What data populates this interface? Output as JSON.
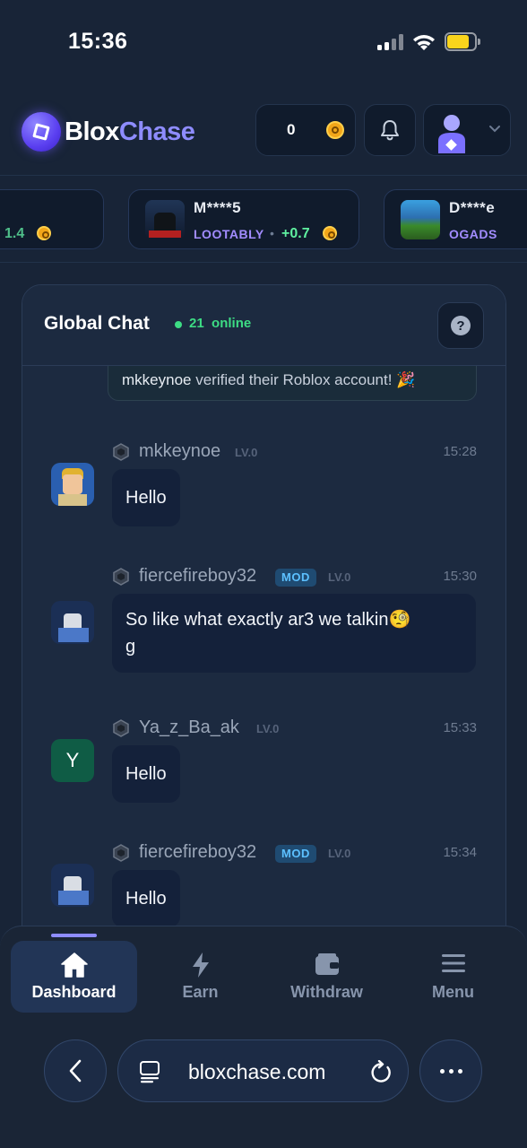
{
  "status_bar": {
    "time": "15:36"
  },
  "header": {
    "logo": {
      "part1": "Blox",
      "part2": "Chase"
    },
    "balance": "0"
  },
  "ticker": [
    {
      "name": "",
      "source": "",
      "amount": "1.4"
    },
    {
      "name": "M****5",
      "source": "LOOTABLY",
      "amount": "+0.7"
    },
    {
      "name": "D****e",
      "source": "OGADS",
      "amount": ""
    }
  ],
  "chat": {
    "title": "Global Chat",
    "online_count": "21",
    "online_label": "online",
    "system_message": {
      "user": "mkkeynoe",
      "text": " verified their Roblox account! ",
      "emoji": "🎉"
    },
    "messages": [
      {
        "user": "mkkeynoe",
        "mod": "",
        "level": "LV.0",
        "time": "15:28",
        "text": "Hello",
        "avatar_letter": ""
      },
      {
        "user": "fiercefireboy32",
        "mod": "MOD",
        "level": "LV.0",
        "time": "15:30",
        "text_line1": "So like what exactly ar3 we talkin🧐",
        "text_line2": "g",
        "avatar_letter": ""
      },
      {
        "user": "Ya_z_Ba_ak",
        "mod": "",
        "level": "LV.0",
        "time": "15:33",
        "text": "Hello",
        "avatar_letter": "Y"
      },
      {
        "user": "fiercefireboy32",
        "mod": "MOD",
        "level": "LV.0",
        "time": "15:34",
        "text": "Hello",
        "avatar_letter": ""
      }
    ]
  },
  "nav": {
    "items": [
      {
        "label": "Dashboard",
        "icon": "home-icon"
      },
      {
        "label": "Earn",
        "icon": "bolt-icon"
      },
      {
        "label": "Withdraw",
        "icon": "wallet-icon"
      },
      {
        "label": "Menu",
        "icon": "menu-icon"
      }
    ]
  },
  "browser": {
    "url": "bloxchase.com"
  },
  "colors": {
    "accent": "#8e8cff",
    "online": "#3ddc84",
    "mod_badge": "#5cc0ff",
    "coin": "#f2a619"
  }
}
